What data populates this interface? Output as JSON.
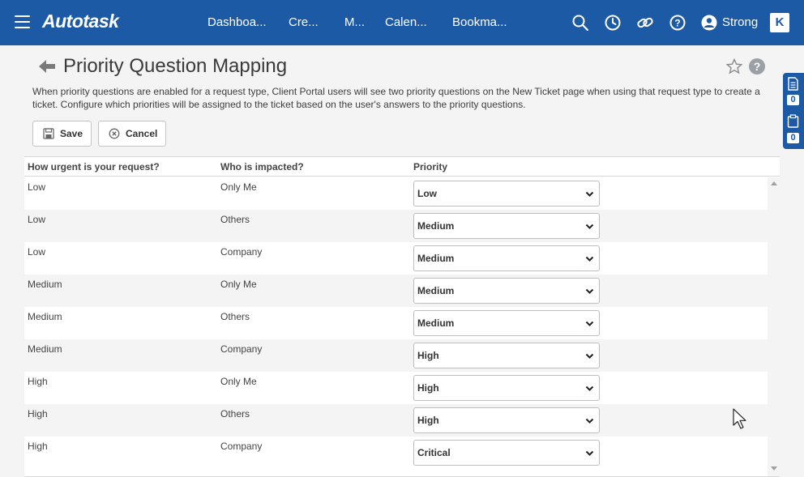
{
  "topbar": {
    "logo": "Autotask",
    "nav": [
      "Dashboa...",
      "Cre...",
      "M...",
      "Calen...",
      "Bookma..."
    ],
    "user_name": "Strong",
    "k_logo": "K",
    "icons": [
      "search-icon",
      "clock-icon",
      "link-icon",
      "help-icon",
      "user-icon"
    ]
  },
  "header": {
    "title": "Priority Question Mapping",
    "help": "?",
    "description": "When priority questions are enabled for a request type, Client Portal users will see two priority questions on the New Ticket page when using that request type to create a ticket. Configure which priorities will be assigned to the ticket based on the user's answers to the priority questions."
  },
  "toolbar": {
    "save_label": "Save",
    "cancel_label": "Cancel"
  },
  "side_panel": {
    "count_1": "0",
    "count_2": "0"
  },
  "table": {
    "columns": [
      "How urgent is your request?",
      "Who is impacted?",
      "Priority"
    ],
    "rows": [
      {
        "urgency": "Low",
        "impacted": "Only Me",
        "priority": "Low"
      },
      {
        "urgency": "Low",
        "impacted": "Others",
        "priority": "Medium"
      },
      {
        "urgency": "Low",
        "impacted": "Company",
        "priority": "Medium"
      },
      {
        "urgency": "Medium",
        "impacted": "Only Me",
        "priority": "Medium"
      },
      {
        "urgency": "Medium",
        "impacted": "Others",
        "priority": "Medium"
      },
      {
        "urgency": "Medium",
        "impacted": "Company",
        "priority": "High"
      },
      {
        "urgency": "High",
        "impacted": "Only Me",
        "priority": "High"
      },
      {
        "urgency": "High",
        "impacted": "Others",
        "priority": "High"
      },
      {
        "urgency": "High",
        "impacted": "Company",
        "priority": "Critical"
      }
    ]
  },
  "colors": {
    "brand": "#1c5aa6",
    "background": "#f4f4f4"
  }
}
